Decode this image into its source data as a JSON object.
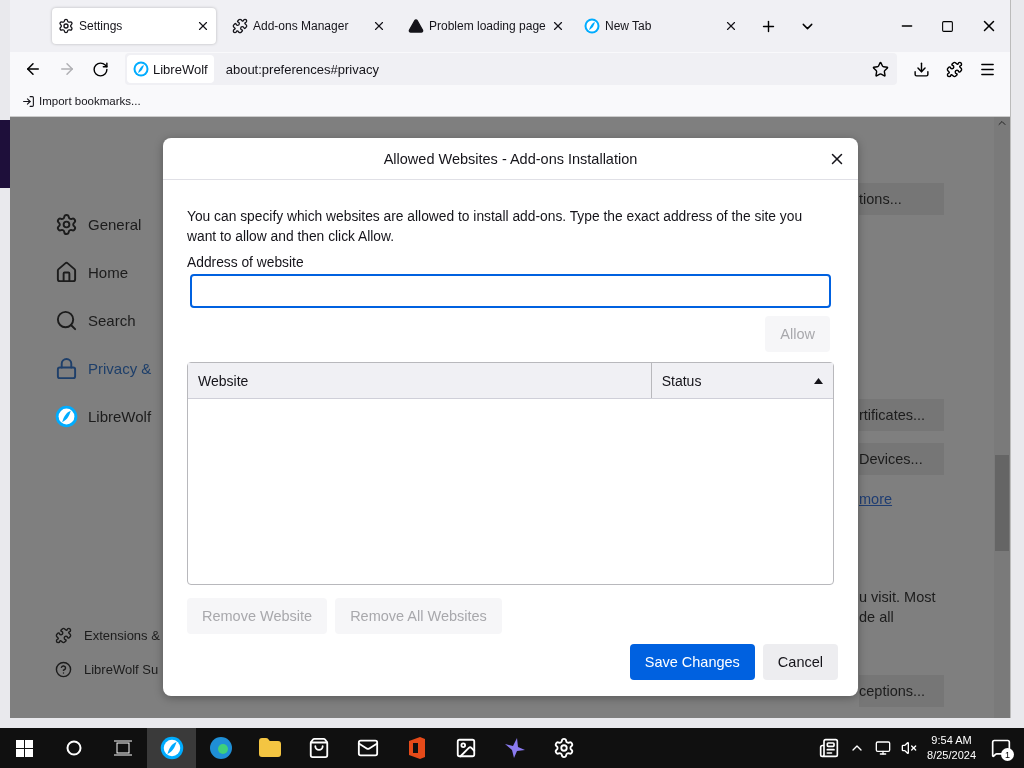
{
  "tabs": [
    {
      "label": "Settings",
      "kind": "settings",
      "selected": true
    },
    {
      "label": "Add-ons Manager",
      "kind": "puzzle",
      "selected": false
    },
    {
      "label": "Problem loading page",
      "kind": "warning",
      "selected": false
    },
    {
      "label": "New Tab",
      "kind": "librewolf",
      "selected": false
    }
  ],
  "toolbar": {
    "identity": "LibreWolf",
    "url": "about:preferences#privacy"
  },
  "bookmarks": [
    "Import bookmarks..."
  ],
  "sidebar": {
    "items": [
      {
        "label": "General",
        "kind": "settings",
        "selected": false
      },
      {
        "label": "Home",
        "kind": "home",
        "selected": false
      },
      {
        "label": "Search",
        "kind": "search",
        "selected": false
      },
      {
        "label": "Privacy &",
        "kind": "lock",
        "selected": true
      },
      {
        "label": "LibreWolf",
        "kind": "librewolf",
        "selected": false
      }
    ],
    "footer": [
      {
        "label": "Extensions &",
        "kind": "puzzle"
      },
      {
        "label": "LibreWolf Su",
        "kind": "help"
      }
    ]
  },
  "page_fragments": [
    {
      "text": "tions...",
      "kind": "button"
    },
    {
      "text": "rtificates...",
      "kind": "button"
    },
    {
      "text": "Devices...",
      "kind": "button"
    },
    {
      "text": "more",
      "kind": "link"
    },
    {
      "text": "u visit. Most",
      "kind": "text"
    },
    {
      "text": "de all",
      "kind": "text"
    },
    {
      "text": "ceptions...",
      "kind": "button"
    }
  ],
  "dialog": {
    "title": "Allowed Websites - Add-ons Installation",
    "description": "You can specify which websites are allowed to install add-ons. Type the exact address of the site you want to allow and then click Allow.",
    "field_label": "Address of website",
    "allow_button": {
      "label": "Allow",
      "disabled": true
    },
    "table": {
      "columns": [
        "Website",
        "Status"
      ]
    },
    "remove_buttons": [
      {
        "label": "Remove Website",
        "disabled": true
      },
      {
        "label": "Remove All Websites",
        "disabled": true
      }
    ],
    "save_button": "Save Changes",
    "cancel_button": "Cancel"
  },
  "taskbar": {
    "time": "9:54 AM",
    "date": "8/25/2024",
    "notifications": "1"
  }
}
